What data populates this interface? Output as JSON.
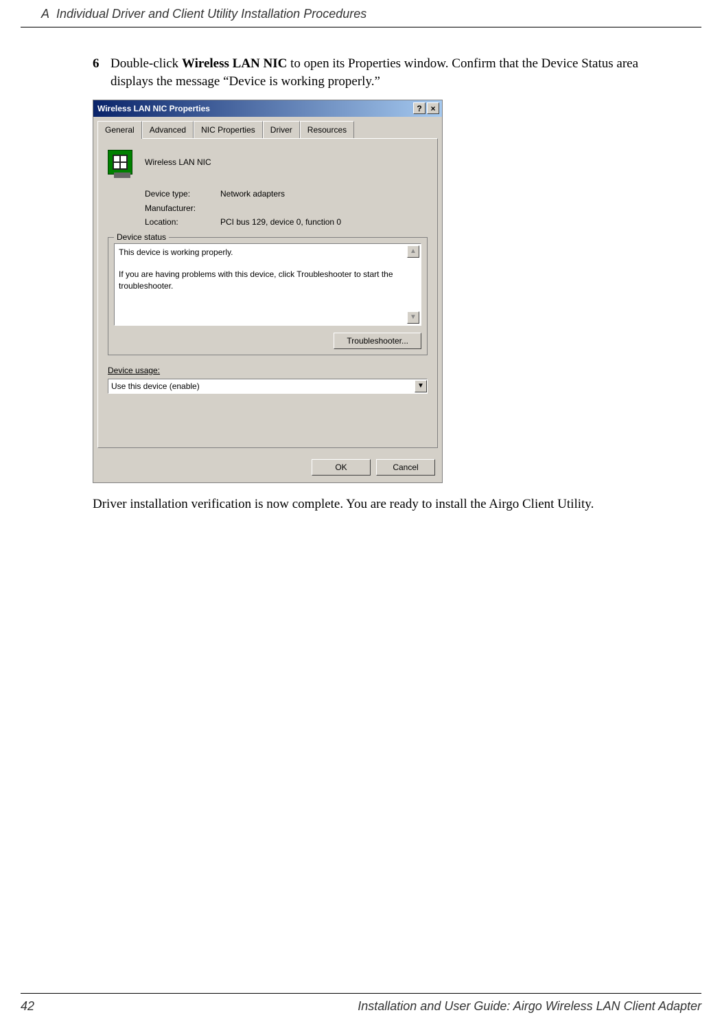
{
  "header": {
    "chapter": "A",
    "title": "Individual Driver and Client Utility Installation Procedures"
  },
  "step": {
    "number": "6",
    "text_before": "Double-click ",
    "bold": "Wireless LAN NIC",
    "text_after": " to open its Properties window. Confirm that the Device Status area displays the message “Device is working properly.”"
  },
  "dialog": {
    "title": "Wireless LAN NIC Properties",
    "help_btn": "?",
    "close_btn": "×",
    "tabs": [
      "General",
      "Advanced",
      "NIC Properties",
      "Driver",
      "Resources"
    ],
    "device_name": "Wireless LAN NIC",
    "rows": {
      "type_label": "Device type:",
      "type_value": "Network adapters",
      "mfg_label": "Manufacturer:",
      "mfg_value": "",
      "loc_label": "Location:",
      "loc_value": "PCI bus 129, device 0, function 0"
    },
    "status": {
      "legend": "Device status",
      "line1": "This device is working properly.",
      "line2": "If you are having problems with this device, click Troubleshooter to start the troubleshooter.",
      "button": "Troubleshooter..."
    },
    "usage": {
      "label": "Device usage:",
      "value": "Use this device (enable)"
    },
    "ok": "OK",
    "cancel": "Cancel"
  },
  "closing": "Driver installation verification is now complete. You are ready to install the Airgo Client Utility.",
  "footer": {
    "page": "42",
    "doc": "Installation and User Guide: Airgo Wireless LAN Client Adapter"
  }
}
